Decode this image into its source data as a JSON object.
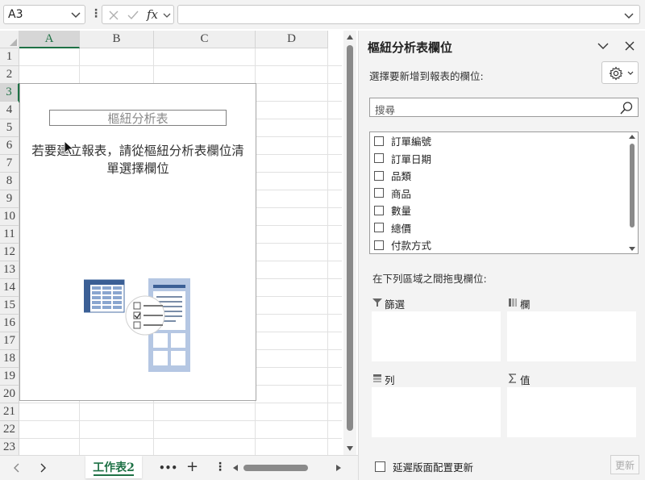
{
  "formula_bar": {
    "name_box": "A3",
    "fx_label": "fx",
    "formula": ""
  },
  "grid": {
    "columns": [
      "A",
      "B",
      "C",
      "D"
    ],
    "rows": [
      "1",
      "2",
      "3",
      "4",
      "5",
      "6",
      "7",
      "8",
      "9",
      "10",
      "11",
      "12",
      "13",
      "14",
      "15",
      "16",
      "17",
      "18",
      "19",
      "20",
      "21",
      "22",
      "23"
    ],
    "selected_column": "A",
    "selected_row": "3"
  },
  "pivot_placeholder": {
    "title": "樞紐分析表",
    "instruction_line1": "若要建立報表，請從樞紐分析表欄位清",
    "instruction_line2": "單選擇欄位"
  },
  "sheet_bar": {
    "tab": "工作表2",
    "more": "•••",
    "add": "+",
    "options": "⋮"
  },
  "pane": {
    "title": "樞紐分析表欄位",
    "subtitle": "選擇要新增到報表的欄位:",
    "search_placeholder": "搜尋",
    "fields": [
      "訂單編號",
      "訂單日期",
      "品類",
      "商品",
      "數量",
      "總價",
      "付款方式"
    ],
    "drag_label": "在下列區域之間拖曳欄位:",
    "areas": {
      "filters": "篩選",
      "columns": "欄",
      "rows": "列",
      "values": "值"
    },
    "defer_label": "延遲版面配置更新",
    "update_label": "更新"
  },
  "colors": {
    "accent_green": "#1e7145",
    "pane_bg": "#f3f3f3",
    "illustration_blue": "#4a6fa5"
  }
}
